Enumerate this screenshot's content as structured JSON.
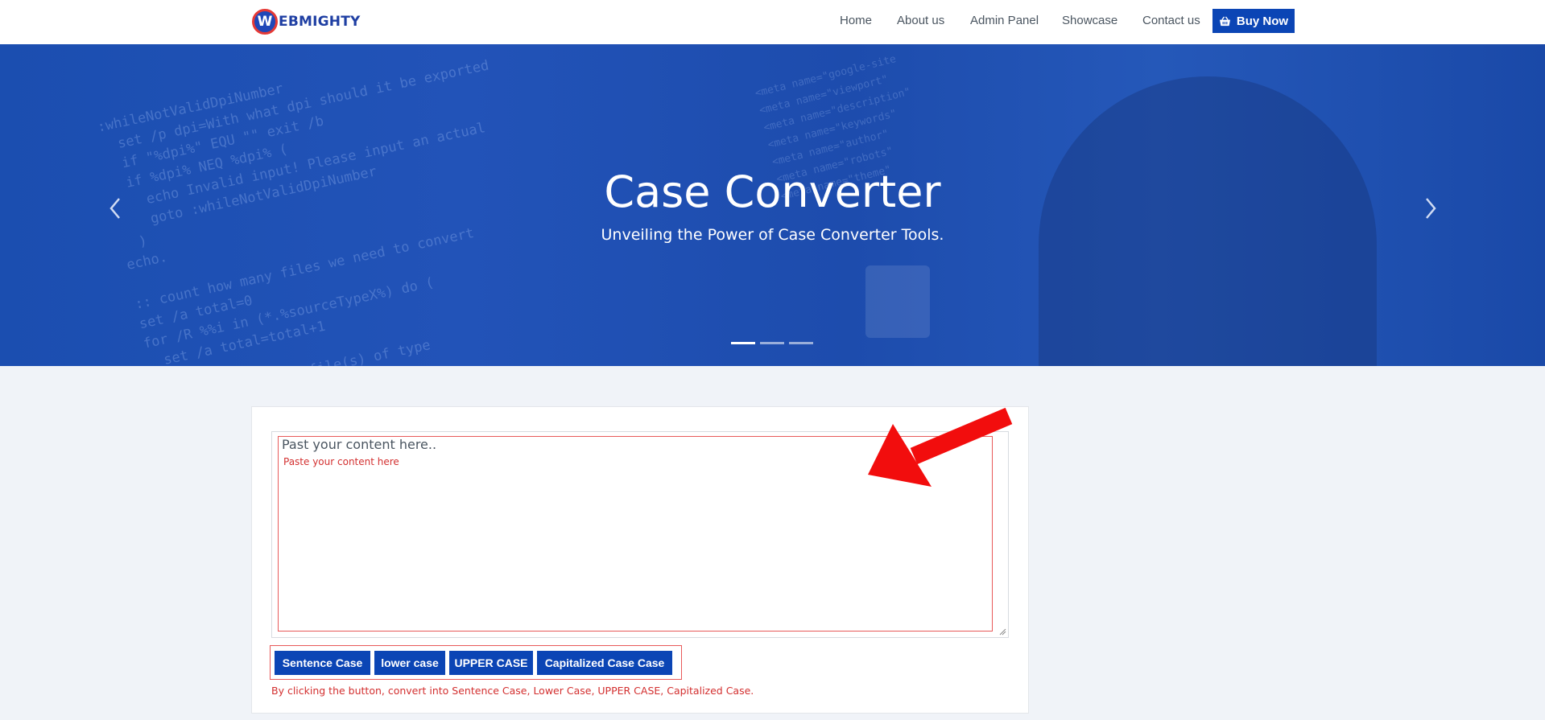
{
  "logo": {
    "letter": "W",
    "text": "EBMIGHTY"
  },
  "nav": {
    "items": [
      "Home",
      "About us",
      "Admin Panel",
      "Showcase",
      "Contact us"
    ],
    "buy_label": "Buy Now"
  },
  "hero": {
    "title": "Case Converter",
    "subtitle": "Unveiling the Power of Case Converter Tools.",
    "slides": 3,
    "active_slide": 1
  },
  "editor": {
    "placeholder": "Past your content here..",
    "hint": "Paste your content here"
  },
  "buttons": {
    "sentence": "Sentence Case",
    "lower": "lower case",
    "upper": "UPPER CASE",
    "capitalized": "Capitalized Case Case"
  },
  "note": "By clicking the button, convert into Sentence Case, Lower Case, UPPER CASE, Capitalized Case.",
  "colors": {
    "brand": "#0b45b5",
    "hero_bg": "#1f4fb2",
    "highlight": "#e85a5a",
    "hint_text": "#d32f2f"
  },
  "icons": {
    "buy": "basket-icon",
    "prev": "chevron-left-icon",
    "next": "chevron-right-icon"
  }
}
